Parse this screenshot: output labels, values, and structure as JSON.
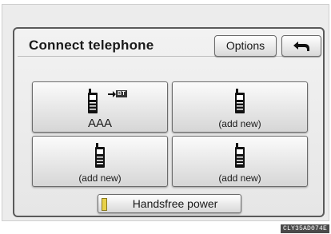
{
  "header": {
    "title": "Connect telephone",
    "options_label": "Options",
    "back_icon": "return-arrow-icon"
  },
  "phone_slots": [
    {
      "label": "AAA",
      "icon": "phone-icon",
      "bluetooth_badge": "BT",
      "connected": true
    },
    {
      "label": "(add new)",
      "icon": "phone-icon"
    },
    {
      "label": "(add new)",
      "icon": "phone-icon"
    },
    {
      "label": "(add new)",
      "icon": "phone-icon"
    }
  ],
  "handsfree": {
    "label": "Handsfree power",
    "indicator_color": "#e8d14a"
  },
  "caption": "CLY35AD074E"
}
